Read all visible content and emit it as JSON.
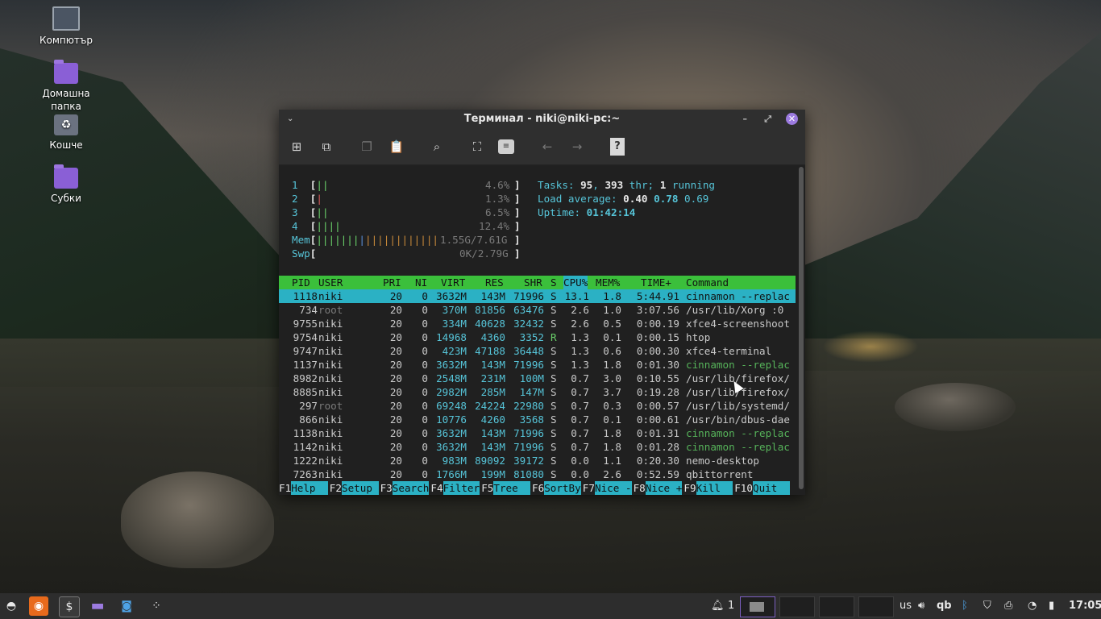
{
  "desktop_icons": [
    {
      "label": "Компютър",
      "icon": "computer-icon"
    },
    {
      "label": "Домашна папка",
      "icon": "home-folder-icon"
    },
    {
      "label": "Кошче",
      "icon": "trash-icon"
    },
    {
      "label": "Субки",
      "icon": "folder-icon"
    }
  ],
  "window": {
    "title": "Терминал - niki@niki-pc:~",
    "close_glyph": "✕"
  },
  "htop": {
    "cpu": [
      {
        "n": "1",
        "bar": "||",
        "val": "4.6%"
      },
      {
        "n": "2",
        "bar": "|",
        "val": "1.3%"
      },
      {
        "n": "3",
        "bar": "||",
        "val": "6.5%"
      },
      {
        "n": "4",
        "bar": "||||",
        "val": "12.4%"
      }
    ],
    "mem": {
      "label": "Mem",
      "val": "1.55G/7.61G"
    },
    "swp": {
      "label": "Swp",
      "val": "0K/2.79G"
    },
    "tasks": {
      "label": "Tasks:",
      "count": "95",
      "thr": "393",
      "thr_label": "thr;",
      "running": "1",
      "running_label": "running"
    },
    "load": {
      "label": "Load average:",
      "v1": "0.40",
      "v2": "0.78",
      "v3": "0.69"
    },
    "uptime": {
      "label": "Uptime:",
      "val": "01:42:14"
    },
    "columns": [
      "PID",
      "USER",
      "PRI",
      "NI",
      "VIRT",
      "RES",
      "SHR",
      "S",
      "CPU%",
      "MEM%",
      "TIME+",
      "Command"
    ],
    "rows": [
      {
        "pid": "1118",
        "user": "niki",
        "pri": "20",
        "ni": "0",
        "virt": "3632M",
        "res": "143M",
        "shr": "71996",
        "s": "S",
        "cpu": "13.1",
        "mem": "1.8",
        "time": "5:44.91",
        "cmd": "cinnamon --replac"
      },
      {
        "pid": "734",
        "user": "root",
        "pri": "20",
        "ni": "0",
        "virt": "370M",
        "res": "81856",
        "shr": "63476",
        "s": "S",
        "cpu": "2.6",
        "mem": "1.0",
        "time": "3:07.56",
        "cmd": "/usr/lib/Xorg :0"
      },
      {
        "pid": "9755",
        "user": "niki",
        "pri": "20",
        "ni": "0",
        "virt": "334M",
        "res": "40628",
        "shr": "32432",
        "s": "S",
        "cpu": "2.6",
        "mem": "0.5",
        "time": "0:00.19",
        "cmd": "xfce4-screenshoot"
      },
      {
        "pid": "9754",
        "user": "niki",
        "pri": "20",
        "ni": "0",
        "virt": "14968",
        "res": "4360",
        "shr": "3352",
        "s": "R",
        "cpu": "1.3",
        "mem": "0.1",
        "time": "0:00.15",
        "cmd": "htop"
      },
      {
        "pid": "9747",
        "user": "niki",
        "pri": "20",
        "ni": "0",
        "virt": "423M",
        "res": "47188",
        "shr": "36448",
        "s": "S",
        "cpu": "1.3",
        "mem": "0.6",
        "time": "0:00.30",
        "cmd": "xfce4-terminal"
      },
      {
        "pid": "1137",
        "user": "niki",
        "pri": "20",
        "ni": "0",
        "virt": "3632M",
        "res": "143M",
        "shr": "71996",
        "s": "S",
        "cpu": "1.3",
        "mem": "1.8",
        "time": "0:01.30",
        "cmd": "cinnamon --replac"
      },
      {
        "pid": "8982",
        "user": "niki",
        "pri": "20",
        "ni": "0",
        "virt": "2548M",
        "res": "231M",
        "shr": "100M",
        "s": "S",
        "cpu": "0.7",
        "mem": "3.0",
        "time": "0:10.55",
        "cmd": "/usr/lib/firefox/"
      },
      {
        "pid": "8885",
        "user": "niki",
        "pri": "20",
        "ni": "0",
        "virt": "2982M",
        "res": "285M",
        "shr": "147M",
        "s": "S",
        "cpu": "0.7",
        "mem": "3.7",
        "time": "0:19.28",
        "cmd": "/usr/lib/firefox/"
      },
      {
        "pid": "297",
        "user": "root",
        "pri": "20",
        "ni": "0",
        "virt": "69248",
        "res": "24224",
        "shr": "22980",
        "s": "S",
        "cpu": "0.7",
        "mem": "0.3",
        "time": "0:00.57",
        "cmd": "/usr/lib/systemd/"
      },
      {
        "pid": "866",
        "user": "niki",
        "pri": "20",
        "ni": "0",
        "virt": "10776",
        "res": "4260",
        "shr": "3568",
        "s": "S",
        "cpu": "0.7",
        "mem": "0.1",
        "time": "0:00.61",
        "cmd": "/usr/bin/dbus-dae"
      },
      {
        "pid": "1138",
        "user": "niki",
        "pri": "20",
        "ni": "0",
        "virt": "3632M",
        "res": "143M",
        "shr": "71996",
        "s": "S",
        "cpu": "0.7",
        "mem": "1.8",
        "time": "0:01.31",
        "cmd": "cinnamon --replac"
      },
      {
        "pid": "1142",
        "user": "niki",
        "pri": "20",
        "ni": "0",
        "virt": "3632M",
        "res": "143M",
        "shr": "71996",
        "s": "S",
        "cpu": "0.7",
        "mem": "1.8",
        "time": "0:01.28",
        "cmd": "cinnamon --replac"
      },
      {
        "pid": "1222",
        "user": "niki",
        "pri": "20",
        "ni": "0",
        "virt": "983M",
        "res": "89092",
        "shr": "39172",
        "s": "S",
        "cpu": "0.0",
        "mem": "1.1",
        "time": "0:20.30",
        "cmd": "nemo-desktop"
      },
      {
        "pid": "7263",
        "user": "niki",
        "pri": "20",
        "ni": "0",
        "virt": "1766M",
        "res": "199M",
        "shr": "81080",
        "s": "S",
        "cpu": "0.0",
        "mem": "2.6",
        "time": "0:52.59",
        "cmd": "qbittorrent"
      }
    ],
    "fkeys": [
      {
        "key": "F1",
        "label": "Help  "
      },
      {
        "key": "F2",
        "label": "Setup "
      },
      {
        "key": "F3",
        "label": "Search"
      },
      {
        "key": "F4",
        "label": "Filter"
      },
      {
        "key": "F5",
        "label": "Tree  "
      },
      {
        "key": "F6",
        "label": "SortBy"
      },
      {
        "key": "F7",
        "label": "Nice -"
      },
      {
        "key": "F8",
        "label": "Nice +"
      },
      {
        "key": "F9",
        "label": "Kill  "
      },
      {
        "key": "F10",
        "label": "Quit  "
      }
    ]
  },
  "taskbar": {
    "notifications_count": "1",
    "keyboard_layout": "us",
    "qb_label": "qb",
    "clock": "17:05"
  }
}
